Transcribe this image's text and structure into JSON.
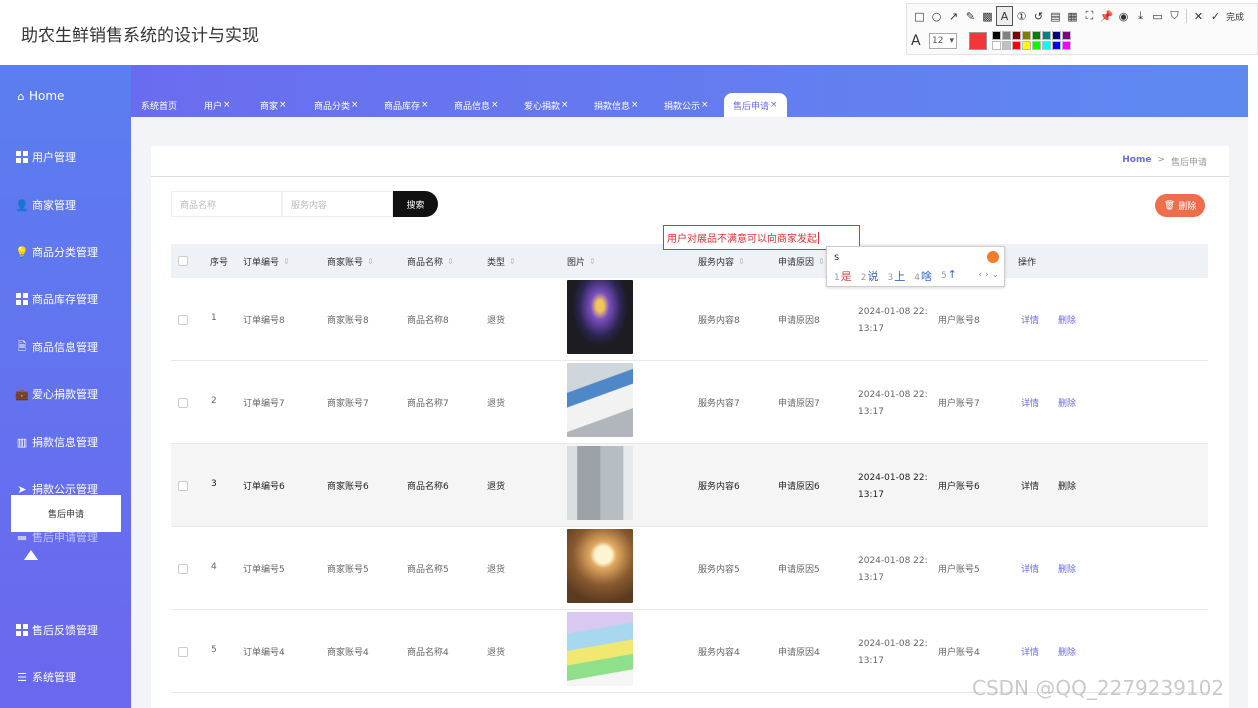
{
  "app": {
    "title": "助农生鲜销售系统的设计与实现"
  },
  "annotation_toolbar": {
    "tools": [
      "rect-icon",
      "ellipse-icon",
      "arrow-icon",
      "pen-icon",
      "mosaic-icon",
      "text-icon",
      "number-icon",
      "undo-icon",
      "ocr-icon",
      "translate-icon",
      "scroll-capture-icon",
      "pin-icon",
      "record-icon",
      "download-icon",
      "save-icon",
      "bookmark-icon"
    ],
    "close_icon": "close-icon",
    "done_label": "完成",
    "font_size": "12",
    "current_color": "#f03838",
    "palette": [
      "#000000",
      "#808080",
      "#800000",
      "#808000",
      "#008000",
      "#008080",
      "#000080",
      "#800080",
      "#ffffff",
      "#c0c0c0",
      "#ff0000",
      "#ffff00",
      "#00ff00",
      "#00ffff",
      "#0000ff",
      "#ff00ff"
    ]
  },
  "sidebar": {
    "home": "Home",
    "items": [
      {
        "label": "用户管理",
        "icon": "grid-icon"
      },
      {
        "label": "商家管理",
        "icon": "user-icon"
      },
      {
        "label": "商品分类管理",
        "icon": "bulb-icon"
      },
      {
        "label": "商品库存管理",
        "icon": "grid-icon"
      },
      {
        "label": "商品信息管理",
        "icon": "doc-icon"
      },
      {
        "label": "爱心捐款管理",
        "icon": "briefcase-icon"
      },
      {
        "label": "捐款信息管理",
        "icon": "columns-icon"
      },
      {
        "label": "捐款公示管理",
        "icon": "send-icon"
      },
      {
        "label": "售后申请管理",
        "icon": "monitor-icon"
      },
      {
        "label": "售后反馈管理",
        "icon": "grid-icon"
      },
      {
        "label": "系统管理",
        "icon": "list-icon"
      }
    ],
    "submenu_item": "售后申请"
  },
  "tabs": [
    {
      "label": "系统首页",
      "closable": false
    },
    {
      "label": "用户",
      "closable": true
    },
    {
      "label": "商家",
      "closable": true
    },
    {
      "label": "商品分类",
      "closable": true
    },
    {
      "label": "商品库存",
      "closable": true
    },
    {
      "label": "商品信息",
      "closable": true
    },
    {
      "label": "爱心捐款",
      "closable": true
    },
    {
      "label": "捐款信息",
      "closable": true
    },
    {
      "label": "捐款公示",
      "closable": true
    },
    {
      "label": "售后申请",
      "closable": true,
      "active": true
    }
  ],
  "close_glyph": "×",
  "breadcrumb": {
    "home": "Home",
    "sep": ">",
    "current": "售后申请"
  },
  "search": {
    "product_name_placeholder": "商品名称",
    "service_content_placeholder": "服务内容",
    "search_button": "搜索"
  },
  "delete_button": "删除",
  "table": {
    "headers": [
      "序号",
      "订单编号",
      "商家账号",
      "商品名称",
      "类型",
      "图片",
      "服务内容",
      "申请原因",
      "",
      "",
      "操作"
    ],
    "rows": [
      {
        "idx": "1",
        "order": "订单编号8",
        "merchant": "商家账号8",
        "product": "商品名称8",
        "type": "退货",
        "image": "tv-cabinet-photo",
        "service": "服务内容8",
        "reason": "申请原因8",
        "date1": "2024-01-08 22:",
        "date2": "13:17",
        "user": "用户账号8"
      },
      {
        "idx": "2",
        "order": "订单编号7",
        "merchant": "商家账号7",
        "product": "商品名称7",
        "type": "退货",
        "image": "sneaker-photo",
        "service": "服务内容7",
        "reason": "申请原因7",
        "date1": "2024-01-08 22:",
        "date2": "13:17",
        "user": "用户账号7"
      },
      {
        "idx": "3",
        "order": "订单编号6",
        "merchant": "商家账号6",
        "product": "商品名称6",
        "type": "退货",
        "image": "refrigerator-photo",
        "service": "服务内容6",
        "reason": "申请原因6",
        "date1": "2024-01-08 22:",
        "date2": "13:17",
        "user": "用户账号6",
        "highlight": true
      },
      {
        "idx": "4",
        "order": "订单编号5",
        "merchant": "商家账号5",
        "product": "商品名称5",
        "type": "退货",
        "image": "lamp-photo",
        "service": "服务内容5",
        "reason": "申请原因5",
        "date1": "2024-01-08 22:",
        "date2": "13:17",
        "user": "用户账号5"
      },
      {
        "idx": "5",
        "order": "订单编号4",
        "merchant": "商家账号4",
        "product": "商品名称4",
        "type": "退货",
        "image": "towels-photo",
        "service": "服务内容4",
        "reason": "申请原因4",
        "date1": "2024-01-08 22:",
        "date2": "13:17",
        "user": "用户账号4"
      }
    ],
    "detail_link": "详情",
    "delete_link": "删除"
  },
  "annotation_text": "用户对展品不满意可以向商家发起",
  "ime": {
    "input": "s",
    "candidates": [
      {
        "n": "1",
        "text": "是"
      },
      {
        "n": "2",
        "text": "说"
      },
      {
        "n": "3",
        "text": "上"
      },
      {
        "n": "4",
        "text": "啥"
      },
      {
        "n": "5",
        "text": "↑"
      }
    ]
  },
  "watermark": "CSDN @QQ_2279239102"
}
